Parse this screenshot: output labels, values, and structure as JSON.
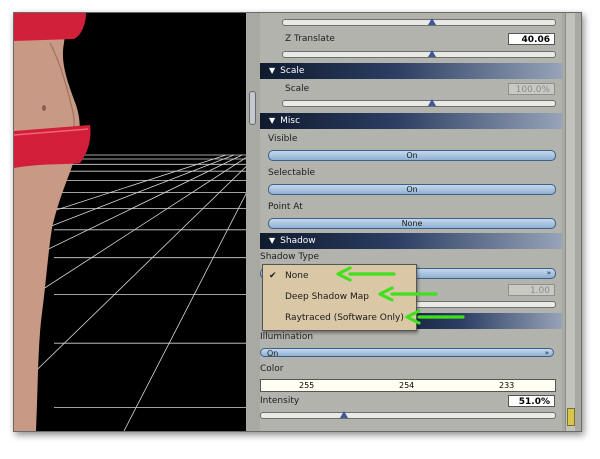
{
  "panel": {
    "z_translate": {
      "label": "Z Translate",
      "value": "40.06"
    },
    "scale_section": {
      "title": "Scale"
    },
    "scale": {
      "label": "Scale",
      "value": "100.0%"
    },
    "misc_section": {
      "title": "Misc"
    },
    "visible": {
      "label": "Visible",
      "value": "On"
    },
    "selectable": {
      "label": "Selectable",
      "value": "On"
    },
    "point_at": {
      "label": "Point At",
      "value": "None"
    },
    "shadow_section": {
      "title": "Shadow"
    },
    "shadow_type": {
      "label": "Shadow Type"
    },
    "hidden_value": "1.00",
    "illumination": {
      "label": "Illumination",
      "value": "On"
    },
    "color": {
      "label": "Color",
      "r": "255",
      "g": "254",
      "b": "233"
    },
    "intensity": {
      "label": "Intensity",
      "value": "51.0%"
    }
  },
  "dropdown": {
    "items": [
      {
        "label": "None",
        "checked": true
      },
      {
        "label": "Deep Shadow Map",
        "checked": false
      },
      {
        "label": "Raytraced (Software Only)",
        "checked": false
      }
    ],
    "check_glyph": "✔"
  },
  "colors": {
    "arrow": "#3fe01c",
    "section_dark": "#0f1a2e",
    "pill": "#8fb1d3"
  }
}
